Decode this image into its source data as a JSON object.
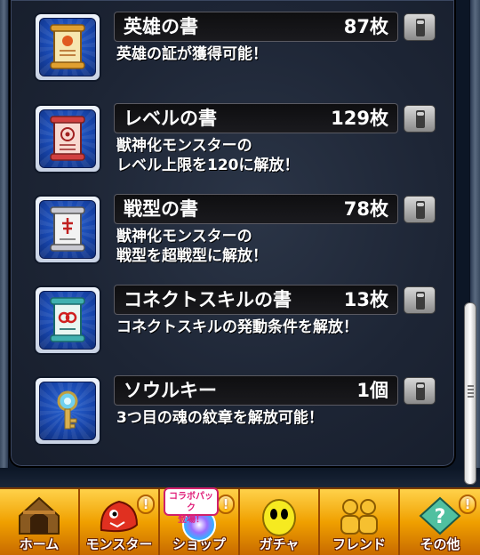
{
  "items": [
    {
      "name": "英雄の書",
      "count": "87枚",
      "desc": "英雄の証が獲得可能！",
      "icon": "scroll-gold-icon"
    },
    {
      "name": "レベルの書",
      "count": "129枚",
      "desc": "獣神化モンスターの\nレベル上限を120に解放！",
      "icon": "scroll-red-icon"
    },
    {
      "name": "戦型の書",
      "count": "78枚",
      "desc": "獣神化モンスターの\n戦型を超戦型に解放！",
      "icon": "scroll-white-icon"
    },
    {
      "name": "コネクトスキルの書",
      "count": "13枚",
      "desc": "コネクトスキルの発動条件を解放！",
      "icon": "scroll-cyan-icon"
    },
    {
      "name": "ソウルキー",
      "count": "1個",
      "desc": "3つ目の魂の紋章を解放可能！",
      "icon": "key-icon"
    }
  ],
  "nav": {
    "home": "ホーム",
    "monster": "モンスター",
    "shop": "ショップ",
    "shop_tag": "コラボパック\n登場！",
    "gacha": "ガチャ",
    "friend": "フレンド",
    "other": "その他",
    "alert": "!"
  },
  "colors": {
    "accent": "#f0a000",
    "icon_bg": "#1846ad"
  }
}
